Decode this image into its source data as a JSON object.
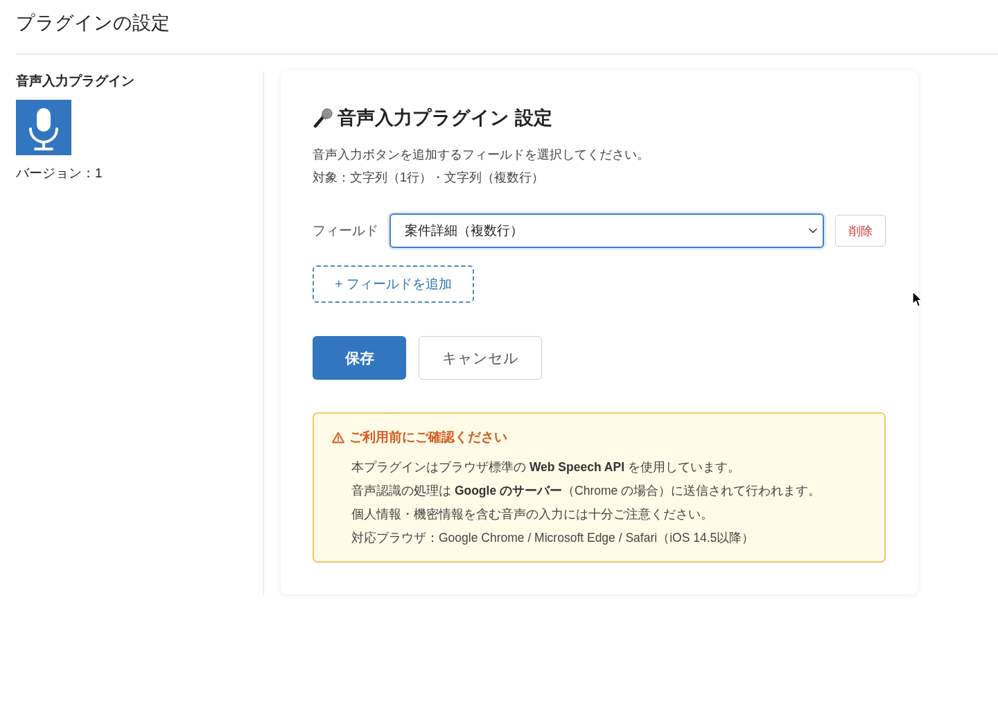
{
  "page_title": "プラグインの設定",
  "plugin": {
    "name": "音声入力プラグイン",
    "version": "バージョン：1"
  },
  "settings": {
    "title": "音声入力プラグイン 設定",
    "description": [
      "音声入力ボタンを追加するフィールドを選択してください。",
      "対象：文字列（1行）・文字列（複数行）"
    ],
    "fields": [
      {
        "label": "フィールド",
        "value": "案件詳細（複数行）",
        "focused": true,
        "delete_label": "削除"
      }
    ],
    "add_field_button": "+ フィールドを追加",
    "buttons": [
      {
        "label": "保存",
        "kind": "primary"
      },
      {
        "label": "キャンセル",
        "kind": "secondary"
      }
    ],
    "notice": {
      "title": "ご利用前にご確認ください",
      "items": [
        "本プラグインはブラウザ標準の **Web Speech API** を使用しています。",
        "音声認識の処理は **Google のサーバー**（Chrome の場合）に送信されて行われます。",
        "個人情報・機密情報を含む音声の入力には十分ご注意ください。",
        "対応ブラウザ：Google Chrome / Microsoft Edge / Safari（iOS 14.5以降）"
      ]
    }
  }
}
